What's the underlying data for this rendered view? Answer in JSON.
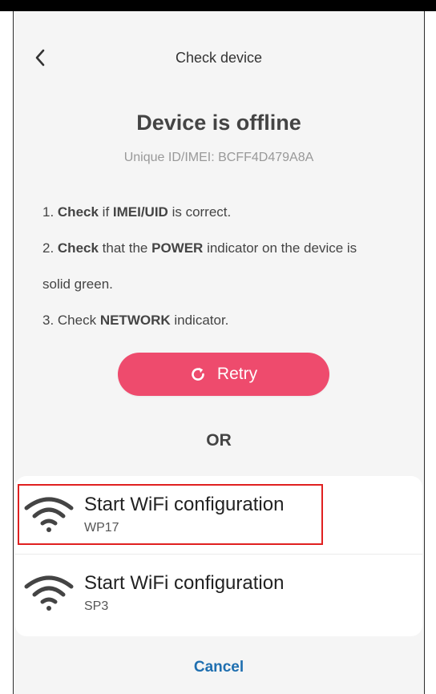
{
  "header": {
    "title": "Check device",
    "back_icon": "chevron-left-icon"
  },
  "status": {
    "title": "Device is offline",
    "uid_text": "Unique ID/IMEI: BCFF4D479A8A"
  },
  "instructions": {
    "step1": {
      "prefix": "1. ",
      "bold1": "Check",
      "mid1": " if ",
      "bold2": "IMEI/UID",
      "suffix": " is correct."
    },
    "step2": {
      "prefix": "2. ",
      "bold1": "Check",
      "mid1": " that the ",
      "bold2": "POWER",
      "suffix_line1": " indicator on the device is",
      "line2": "solid green."
    },
    "step3": {
      "prefix": "3. Check ",
      "bold1": "NETWORK",
      "suffix": " indicator."
    }
  },
  "retry": {
    "label": "Retry",
    "icon": "refresh-icon",
    "color": "#ee4b6d"
  },
  "or_text": "OR",
  "options": [
    {
      "title": "Start WiFi configuration",
      "subtitle": "WP17",
      "icon": "wifi-icon",
      "highlighted": true
    },
    {
      "title": "Start WiFi configuration",
      "subtitle": "SP3",
      "icon": "wifi-icon",
      "highlighted": false
    }
  ],
  "cancel_label": "Cancel",
  "colors": {
    "accent_link": "#1f6fb0",
    "highlight_border": "#e02020"
  }
}
